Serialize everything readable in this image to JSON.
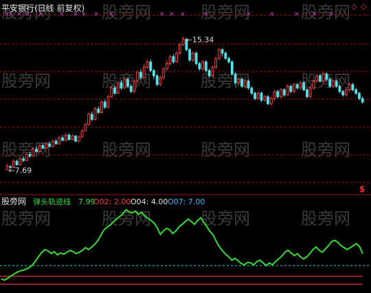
{
  "header": {
    "title": "平安银行(日线 前复权)"
  },
  "indicator": {
    "site": "股旁网",
    "name": "弹头轨迹线",
    "value": "7.99",
    "items": [
      {
        "key": "O02",
        "value": "2.00",
        "color": "#ff3333"
      },
      {
        "key": "O04",
        "value": "4.00",
        "color": "#e0e0e0"
      },
      {
        "key": "O07",
        "value": "7.00",
        "color": "#33bbff"
      }
    ]
  },
  "watermark": "股旁网",
  "annotations": {
    "high_label": "15.34",
    "low_label": "7.69"
  },
  "icons": {
    "top_right": "diamond-icons",
    "dollar_marker": "$"
  },
  "colors": {
    "background": "#000000",
    "up": "#ff3b3b",
    "down": "#55e0e8",
    "grid": "#a01010",
    "indicator_line": "#33dd33",
    "ref_line_cyan": "#33cccc",
    "ref_line_red": "#ff3333",
    "signal_x": "#cc44cc"
  },
  "chart_data": [
    {
      "type": "candlestick",
      "title": "平安银行(日线 前复权)",
      "ylim": [
        6.8,
        16.5
      ],
      "annotations": [
        {
          "text": "15.34",
          "value": 15.34
        },
        {
          "text": "7.69",
          "value": 7.69
        }
      ],
      "candles": [
        [
          7.7,
          7.9,
          8.05,
          7.69
        ],
        [
          7.9,
          7.85,
          8.0,
          7.75
        ],
        [
          7.85,
          8.2,
          8.3,
          7.8
        ],
        [
          8.2,
          8.0,
          8.3,
          7.95
        ],
        [
          8.0,
          8.35,
          8.45,
          7.95
        ],
        [
          8.35,
          8.25,
          8.5,
          8.15
        ],
        [
          8.25,
          8.6,
          8.7,
          8.2
        ],
        [
          8.6,
          8.5,
          8.75,
          8.4
        ],
        [
          8.5,
          8.9,
          9.0,
          8.45
        ],
        [
          8.9,
          8.75,
          9.05,
          8.7
        ],
        [
          8.75,
          9.1,
          9.2,
          8.7
        ],
        [
          9.1,
          8.95,
          9.25,
          8.9
        ],
        [
          8.95,
          9.2,
          9.3,
          8.9
        ],
        [
          9.2,
          9.05,
          9.35,
          9.0
        ],
        [
          9.05,
          9.35,
          9.45,
          9.0
        ],
        [
          9.35,
          9.2,
          9.5,
          9.15
        ],
        [
          9.2,
          9.55,
          9.65,
          9.15
        ],
        [
          9.55,
          9.4,
          9.7,
          9.35
        ],
        [
          9.4,
          9.7,
          9.8,
          9.35
        ],
        [
          9.7,
          9.45,
          9.8,
          9.4
        ],
        [
          9.45,
          9.65,
          9.75,
          9.4
        ],
        [
          9.65,
          9.35,
          9.7,
          9.3
        ],
        [
          9.35,
          9.6,
          9.7,
          9.3
        ],
        [
          9.6,
          9.95,
          10.05,
          9.55
        ],
        [
          9.95,
          10.3,
          10.4,
          9.9
        ],
        [
          10.3,
          10.9,
          11.0,
          10.25
        ],
        [
          10.9,
          10.6,
          11.05,
          10.5
        ],
        [
          10.6,
          11.2,
          11.3,
          10.55
        ],
        [
          11.2,
          11.0,
          11.35,
          10.9
        ],
        [
          11.0,
          11.6,
          11.7,
          10.95
        ],
        [
          11.6,
          11.3,
          11.75,
          11.2
        ],
        [
          11.3,
          11.9,
          12.0,
          11.25
        ],
        [
          11.9,
          12.4,
          12.5,
          11.85
        ],
        [
          12.4,
          12.1,
          12.55,
          12.0
        ],
        [
          12.1,
          12.7,
          12.8,
          12.05
        ],
        [
          12.7,
          12.4,
          12.85,
          12.3
        ],
        [
          12.4,
          12.9,
          13.0,
          12.35
        ],
        [
          12.9,
          12.5,
          13.0,
          12.4
        ],
        [
          12.5,
          12.2,
          12.6,
          12.1
        ],
        [
          12.2,
          12.8,
          12.9,
          12.1
        ],
        [
          12.8,
          13.3,
          13.4,
          12.7
        ],
        [
          13.3,
          13.0,
          13.5,
          12.9
        ],
        [
          13.0,
          13.6,
          13.8,
          12.95
        ],
        [
          13.6,
          13.9,
          14.0,
          13.5
        ],
        [
          13.9,
          13.4,
          14.05,
          13.3
        ],
        [
          13.4,
          13.1,
          13.5,
          12.9
        ],
        [
          13.1,
          12.6,
          13.2,
          12.5
        ],
        [
          12.6,
          13.0,
          13.1,
          12.5
        ],
        [
          13.0,
          13.5,
          13.6,
          12.9
        ],
        [
          13.5,
          13.8,
          14.0,
          13.4
        ],
        [
          13.8,
          14.2,
          14.3,
          13.7
        ],
        [
          14.2,
          13.9,
          14.35,
          13.8
        ],
        [
          13.9,
          14.4,
          14.5,
          13.85
        ],
        [
          14.4,
          14.9,
          15.0,
          14.3
        ],
        [
          14.9,
          15.2,
          15.34,
          14.8
        ],
        [
          15.2,
          14.6,
          15.25,
          14.5
        ],
        [
          14.6,
          14.0,
          14.7,
          13.9
        ],
        [
          14.0,
          14.4,
          14.5,
          13.9
        ],
        [
          14.4,
          13.8,
          14.5,
          13.7
        ],
        [
          13.8,
          13.5,
          13.9,
          13.4
        ],
        [
          13.5,
          13.9,
          14.0,
          13.4
        ],
        [
          13.9,
          13.4,
          14.0,
          13.3
        ],
        [
          13.4,
          13.1,
          13.5,
          13.0
        ],
        [
          13.1,
          13.6,
          13.7,
          13.0
        ],
        [
          13.6,
          14.1,
          14.2,
          13.5
        ],
        [
          14.1,
          14.6,
          14.7,
          14.0
        ],
        [
          14.6,
          14.4,
          14.7,
          14.2
        ],
        [
          14.4,
          14.1,
          14.5,
          14.0
        ],
        [
          14.1,
          13.9,
          14.2,
          13.8
        ],
        [
          13.9,
          13.2,
          14.0,
          13.1
        ],
        [
          13.2,
          12.7,
          13.3,
          12.6
        ],
        [
          12.7,
          12.9,
          13.0,
          12.6
        ],
        [
          12.9,
          12.5,
          13.0,
          12.4
        ],
        [
          12.5,
          12.8,
          12.9,
          12.4
        ],
        [
          12.8,
          12.4,
          12.9,
          12.3
        ],
        [
          12.4,
          12.1,
          12.5,
          12.0
        ],
        [
          12.1,
          11.8,
          12.2,
          11.7
        ],
        [
          11.8,
          12.1,
          12.2,
          11.75
        ],
        [
          12.1,
          11.7,
          12.2,
          11.6
        ],
        [
          11.7,
          11.9,
          12.0,
          11.6
        ],
        [
          11.9,
          11.5,
          12.0,
          11.4
        ],
        [
          11.5,
          11.8,
          11.9,
          11.4
        ],
        [
          11.8,
          12.2,
          12.3,
          11.7
        ],
        [
          12.2,
          11.9,
          12.3,
          11.8
        ],
        [
          11.9,
          12.3,
          12.4,
          11.8
        ],
        [
          12.3,
          12.0,
          12.4,
          11.9
        ],
        [
          12.0,
          12.5,
          12.6,
          11.95
        ],
        [
          12.5,
          12.2,
          12.6,
          12.1
        ],
        [
          12.2,
          12.6,
          12.7,
          12.1
        ],
        [
          12.6,
          12.4,
          12.7,
          12.3
        ],
        [
          12.4,
          12.7,
          12.8,
          12.3
        ],
        [
          12.7,
          12.3,
          12.8,
          12.2
        ],
        [
          12.3,
          11.9,
          12.4,
          11.8
        ],
        [
          11.9,
          12.4,
          12.5,
          11.85
        ],
        [
          12.4,
          12.8,
          12.9,
          12.3
        ],
        [
          12.8,
          13.1,
          13.2,
          12.7
        ],
        [
          13.1,
          12.8,
          13.2,
          12.7
        ],
        [
          12.8,
          13.2,
          13.3,
          12.7
        ],
        [
          13.2,
          12.9,
          13.3,
          12.8
        ],
        [
          12.9,
          12.5,
          13.0,
          12.4
        ],
        [
          12.5,
          12.8,
          12.9,
          12.4
        ],
        [
          12.8,
          12.5,
          12.9,
          12.4
        ],
        [
          12.5,
          12.2,
          12.6,
          12.1
        ],
        [
          12.2,
          12.0,
          12.3,
          11.9
        ],
        [
          12.0,
          12.3,
          12.4,
          11.9
        ],
        [
          12.3,
          12.6,
          12.7,
          12.2
        ],
        [
          12.6,
          12.3,
          12.7,
          12.2
        ],
        [
          12.3,
          12.1,
          12.4,
          12.0
        ],
        [
          12.1,
          11.8,
          12.2,
          11.7
        ],
        [
          11.8,
          11.6,
          11.9,
          11.5
        ]
      ]
    },
    {
      "type": "line",
      "title": "弹头轨迹线",
      "ylim": [
        -0.5,
        11.5
      ],
      "reference_lines": [
        {
          "name": "O02",
          "value": 2.0
        },
        {
          "name": "O04",
          "value": 4.0
        },
        {
          "name": "O07",
          "value": 7.0
        }
      ],
      "series": [
        {
          "name": "弹头轨迹线",
          "values": [
            0.8,
            0.6,
            0.9,
            1.2,
            1.5,
            1.8,
            2.0,
            2.1,
            2.3,
            2.5,
            2.9,
            3.5,
            4.2,
            4.8,
            5.2,
            5.0,
            4.6,
            4.9,
            4.4,
            4.7,
            4.5,
            4.8,
            5.1,
            4.9,
            4.6,
            4.8,
            5.1,
            5.5,
            5.2,
            5.6,
            6.0,
            6.6,
            7.4,
            8.2,
            8.6,
            8.9,
            9.4,
            9.8,
            10.2,
            10.6,
            11.2,
            10.9,
            10.7,
            11.0,
            10.5,
            10.8,
            10.3,
            9.9,
            9.6,
            9.2,
            8.5,
            7.5,
            8.0,
            8.4,
            8.2,
            7.6,
            8.0,
            8.6,
            9.0,
            9.4,
            9.8,
            9.4,
            9.0,
            9.6,
            10.0,
            9.3,
            8.6,
            7.9,
            7.4,
            6.4,
            5.6,
            5.0,
            4.5,
            4.1,
            3.6,
            3.9,
            3.5,
            3.1,
            2.9,
            3.3,
            3.2,
            2.9,
            3.4,
            3.6,
            3.2,
            2.8,
            3.2,
            2.9,
            3.4,
            3.8,
            4.2,
            4.8,
            5.1,
            4.7,
            4.3,
            4.6,
            4.1,
            3.8,
            4.1,
            4.6,
            5.2,
            5.6,
            5.1,
            4.8,
            5.3,
            5.8,
            6.4,
            6.6,
            6.3,
            5.8,
            5.5,
            5.2,
            5.5,
            5.8,
            6.1,
            5.6,
            4.6
          ]
        }
      ]
    }
  ]
}
